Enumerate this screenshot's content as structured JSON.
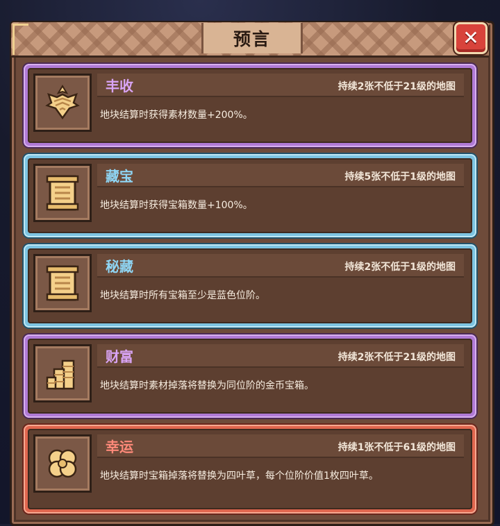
{
  "dialog": {
    "title": "预言",
    "close_label": "✕"
  },
  "prophecies": [
    {
      "name": "丰收",
      "condition": "持续2张不低于21级的地图",
      "description": "地块结算时获得素材数量+200%。",
      "rarity_color": "#b07ad6",
      "icon": "wheat-emblem-icon"
    },
    {
      "name": "藏宝",
      "condition": "持续5张不低于1级的地图",
      "description": "地块结算时获得宝箱数量+100%。",
      "rarity_color": "#7cc4e2",
      "icon": "scroll-chest-icon"
    },
    {
      "name": "秘藏",
      "condition": "持续2张不低于1级的地图",
      "description": "地块结算时所有宝箱至少是蓝色位阶。",
      "rarity_color": "#7cc4e2",
      "icon": "scroll-chest-icon"
    },
    {
      "name": "财富",
      "condition": "持续2张不低于21级的地图",
      "description": "地块结算时素材掉落将替换为同位阶的金币宝箱。",
      "rarity_color": "#b07ad6",
      "icon": "coin-stack-icon"
    },
    {
      "name": "幸运",
      "condition": "持续1张不低于61级的地图",
      "description": "地块结算时宝箱掉落将替换为四叶草，每个位阶价值1枚四叶草。",
      "rarity_color": "#e0664e",
      "icon": "four-leaf-clover-icon"
    }
  ]
}
